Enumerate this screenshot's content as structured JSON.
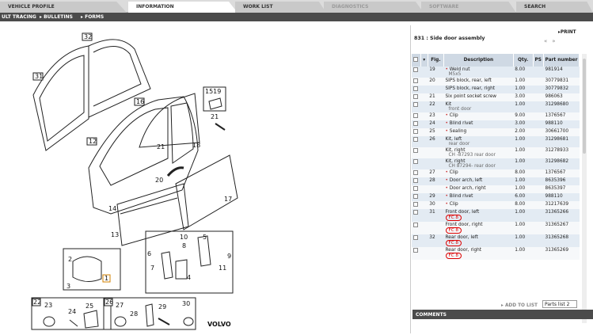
{
  "tabs": [
    {
      "label": "VEHICLE PROFILE",
      "state": "normal"
    },
    {
      "label": "INFORMATION",
      "state": "active"
    },
    {
      "label": "WORK LIST",
      "state": "normal"
    },
    {
      "label": "DIAGNOSTICS",
      "state": "disabled"
    },
    {
      "label": "SOFTWARE",
      "state": "disabled"
    },
    {
      "label": "SEARCH",
      "state": "normal"
    }
  ],
  "subtabs": [
    "ULT TRACING",
    "BULLETINS",
    "FORMS"
  ],
  "panel": {
    "title": "831 : Side door assembly",
    "print": "PRINT",
    "columns": [
      "Fig.",
      "Description",
      "Qty.",
      "PS",
      "Part number"
    ],
    "rows": [
      {
        "fig": "19",
        "bullet": true,
        "desc": "Weld nut",
        "sub": "M5x5",
        "qty": "8.00",
        "part": "981914"
      },
      {
        "fig": "20",
        "bullet": false,
        "desc": "SIPS block, rear, left",
        "sub": "",
        "qty": "1.00",
        "part": "30779831"
      },
      {
        "fig": "",
        "bullet": false,
        "desc": "SIPS block, rear, right",
        "sub": "",
        "qty": "1.00",
        "part": "30779832"
      },
      {
        "fig": "21",
        "bullet": false,
        "desc": "Six point socket screw",
        "sub": "",
        "qty": "3.00",
        "part": "986063"
      },
      {
        "fig": "22",
        "bullet": false,
        "desc": "Kit",
        "sub": "front door",
        "qty": "1.00",
        "part": "31298680"
      },
      {
        "fig": "23",
        "bullet": true,
        "desc": "Clip",
        "sub": "",
        "qty": "9.00",
        "part": "1376567"
      },
      {
        "fig": "24",
        "bullet": true,
        "desc": "Blind rivet",
        "sub": "",
        "qty": "3.00",
        "part": "988110"
      },
      {
        "fig": "25",
        "bullet": true,
        "desc": "Sealing",
        "sub": "",
        "qty": "2.00",
        "part": "30661700"
      },
      {
        "fig": "26",
        "bullet": false,
        "desc": "Kit, left",
        "sub": "rear door",
        "qty": "1.00",
        "part": "31298681"
      },
      {
        "fig": "",
        "bullet": false,
        "desc": "Kit, right",
        "sub": "CH -87293|rear door",
        "qty": "1.00",
        "part": "31278933"
      },
      {
        "fig": "",
        "bullet": false,
        "desc": "Kit, right",
        "sub": "CH 87294-|rear door",
        "qty": "1.00",
        "part": "31298682"
      },
      {
        "fig": "27",
        "bullet": true,
        "desc": "Clip",
        "sub": "",
        "qty": "8.00",
        "part": "1376567"
      },
      {
        "fig": "28",
        "bullet": true,
        "desc": "Door arch, left",
        "sub": "",
        "qty": "1.00",
        "part": "8635396"
      },
      {
        "fig": "",
        "bullet": true,
        "desc": "Door arch, right",
        "sub": "",
        "qty": "1.00",
        "part": "8635397"
      },
      {
        "fig": "29",
        "bullet": true,
        "desc": "Blind rivet",
        "sub": "",
        "qty": "6.00",
        "part": "988110"
      },
      {
        "fig": "30",
        "bullet": true,
        "desc": "Clip",
        "sub": "",
        "qty": "8.00",
        "part": "31217639"
      },
      {
        "fig": "31",
        "bullet": false,
        "desc": "Front door, left",
        "sub": "",
        "fc": "FC 8",
        "qty": "1.00",
        "part": "31365266"
      },
      {
        "fig": "",
        "bullet": false,
        "desc": "Front door, right",
        "sub": "",
        "fc": "FC 8",
        "qty": "1.00",
        "part": "31365267"
      },
      {
        "fig": "32",
        "bullet": false,
        "desc": "Rear door, left",
        "sub": "",
        "fc": "FC 8",
        "qty": "1.00",
        "part": "31365268"
      },
      {
        "fig": "",
        "bullet": false,
        "desc": "Rear door, right",
        "sub": "",
        "fc": "FC 8",
        "qty": "1.00",
        "part": "31365269"
      }
    ],
    "add_to_list": "ADD TO LIST",
    "parts_list": "Parts list 2",
    "comments": "COMMENTS"
  },
  "diagram": {
    "callouts": [
      "32",
      "31",
      "16",
      "1519",
      "21",
      "12",
      "21",
      "18",
      "20",
      "17",
      "14",
      "13",
      "10",
      "8",
      "5",
      "6",
      "7",
      "9",
      "4",
      "11",
      "2",
      "1",
      "3",
      "22",
      "23",
      "24",
      "25",
      "26",
      "27",
      "28",
      "29",
      "30"
    ],
    "brand": "VOLVO"
  }
}
